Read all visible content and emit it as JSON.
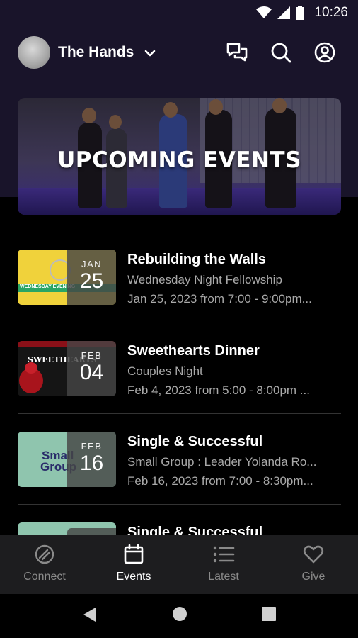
{
  "status_bar": {
    "time": "10:26"
  },
  "header": {
    "group_name": "The Hands"
  },
  "banner": {
    "title": "UPCOMING EVENTS"
  },
  "events": [
    {
      "title": "Rebuilding the Walls",
      "subtitle": "Wednesday Night Fellowship",
      "time": "Jan 25, 2023 from 7:00 - 9:00pm...",
      "month": "JAN",
      "day": "25",
      "thumb_text": "WEDNESDAY EVENING"
    },
    {
      "title": "Sweethearts Dinner",
      "subtitle": "Couples Night",
      "time": "Feb 4, 2023 from 5:00 - 8:00pm ...",
      "month": "FEB",
      "day": "04",
      "thumb_text": "SWEETHEARTS"
    },
    {
      "title": "Single & Successful",
      "subtitle": "Small Group : Leader Yolanda Ro...",
      "time": "Feb 16, 2023 from 7:00 - 8:30pm...",
      "month": "FEB",
      "day": "16",
      "thumb_text_1": "Small",
      "thumb_text_2": "Group"
    },
    {
      "title": "Single & Successful"
    }
  ],
  "bottom_nav": [
    {
      "label": "Connect",
      "icon": "connect-icon"
    },
    {
      "label": "Events",
      "icon": "calendar-icon",
      "active": true
    },
    {
      "label": "Latest",
      "icon": "list-icon"
    },
    {
      "label": "Give",
      "icon": "heart-icon"
    }
  ],
  "colors": {
    "header_bg": "#19142a",
    "nav_bg": "#1d1d1f",
    "thumb_green": "#8fc5ae",
    "thumb_yellow": "#f3d53a"
  }
}
